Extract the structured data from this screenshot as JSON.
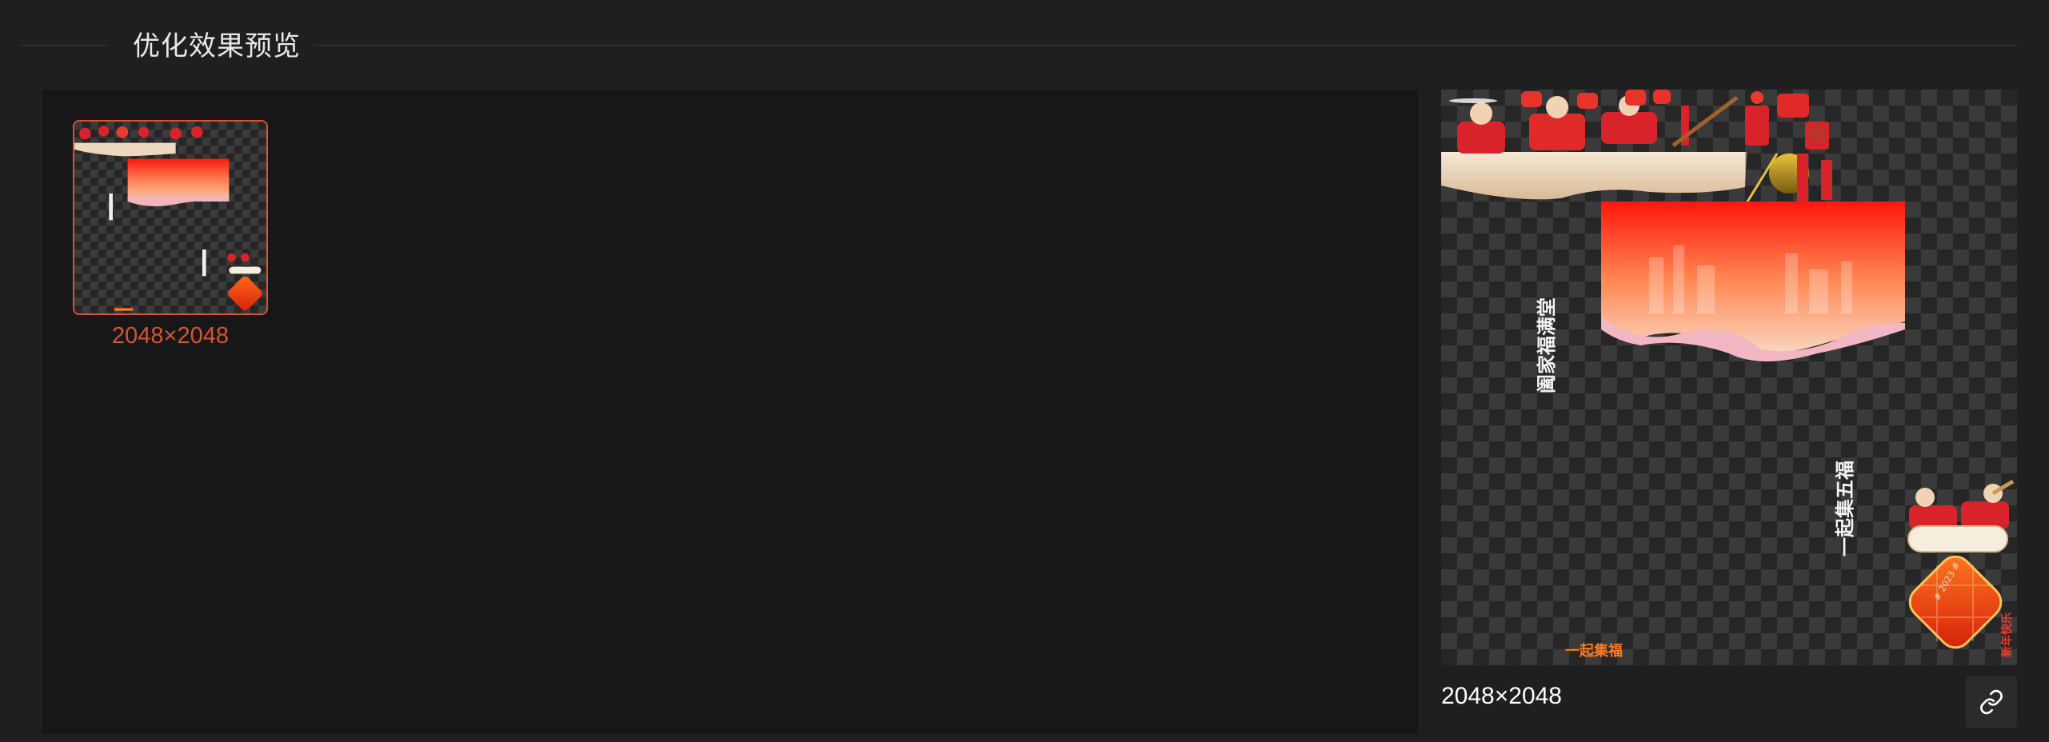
{
  "section": {
    "title": "优化效果预览"
  },
  "thumbnail": {
    "size_label": "2048×2048",
    "selected": true,
    "accent": "#d6542f"
  },
  "preview": {
    "size_label": "2048×2048",
    "vertical_text_left": "阖家福满堂",
    "vertical_text_right": "一起集五福",
    "bottom_text": "一起集福",
    "badge_text": "# 2023 #",
    "corner_text": "新年快乐",
    "link_icon": "link-icon"
  },
  "colors": {
    "background": "#1f1f20",
    "panel": "#17171a",
    "accent": "#d6542f",
    "checker_dark": "#262626",
    "checker_light": "#3a3a3a"
  }
}
